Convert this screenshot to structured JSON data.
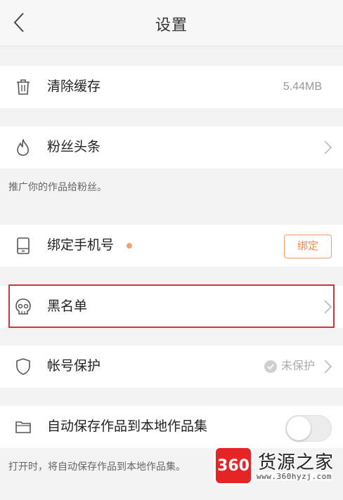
{
  "header": {
    "title": "设置",
    "back_icon": "chevron-left-icon"
  },
  "settings": {
    "clear_cache": {
      "label": "清除缓存",
      "value": "5.44MB",
      "icon": "trash-icon"
    },
    "fan_headlines": {
      "label": "粉丝头条",
      "icon": "flame-icon",
      "caption": "推广你的作品给粉丝。"
    },
    "bind_phone": {
      "label": "绑定手机号",
      "button_label": "绑定",
      "icon": "phone-icon"
    },
    "blacklist": {
      "label": "黑名单",
      "icon": "skull-icon"
    },
    "account_protection": {
      "label": "帐号保护",
      "status": "未保护",
      "icon": "shield-icon"
    },
    "auto_save": {
      "label": "自动保存作品到本地作品集",
      "icon": "folder-icon",
      "enabled": false,
      "caption": "打开时，将自动保存作品到本地作品集。"
    }
  },
  "watermark": {
    "logo_text": "360",
    "name": "货源之家",
    "url": "www.360hyzj.com"
  },
  "colors": {
    "accent": "#ef8a52",
    "highlight_border": "#d6333c",
    "background": "#f3f3f3"
  }
}
